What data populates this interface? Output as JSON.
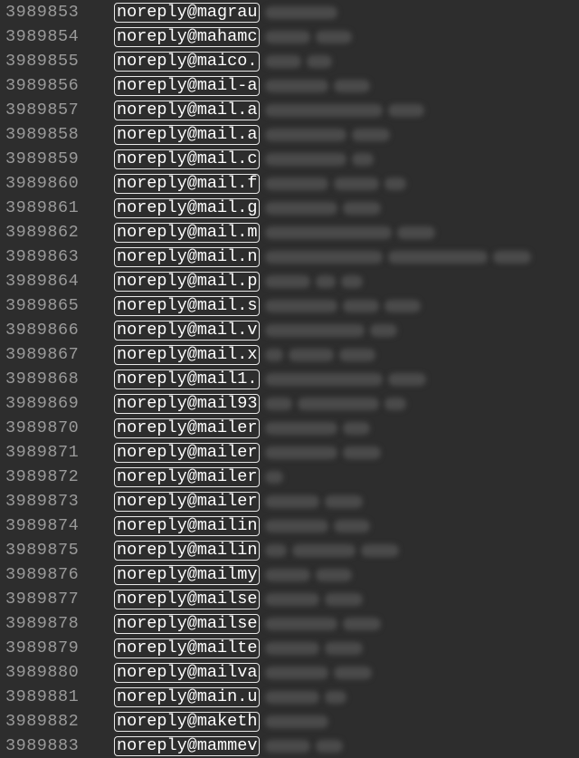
{
  "rows": [
    {
      "line": "3989853",
      "match": "noreply@magrau",
      "tail_char": "",
      "tail_widths": [
        80
      ]
    },
    {
      "line": "3989854",
      "match": "noreply@mahamc",
      "tail_char": "",
      "tail_widths": [
        50,
        40
      ]
    },
    {
      "line": "3989855",
      "match": "noreply@maico.",
      "tail_char": "",
      "tail_widths": [
        40,
        28
      ]
    },
    {
      "line": "3989856",
      "match": "noreply@mail-a",
      "tail_char": "",
      "tail_widths": [
        70,
        40
      ]
    },
    {
      "line": "3989857",
      "match": "noreply@mail.a",
      "tail_char": "",
      "tail_widths": [
        130,
        40
      ]
    },
    {
      "line": "3989858",
      "match": "noreply@mail.a",
      "tail_char": "",
      "tail_widths": [
        90,
        42
      ]
    },
    {
      "line": "3989859",
      "match": "noreply@mail.c",
      "tail_char": "",
      "tail_widths": [
        90,
        24
      ]
    },
    {
      "line": "3989860",
      "match": "noreply@mail.f",
      "tail_char": "",
      "tail_widths": [
        70,
        50,
        24
      ]
    },
    {
      "line": "3989861",
      "match": "noreply@mail.g",
      "tail_char": "",
      "tail_widths": [
        80,
        42
      ]
    },
    {
      "line": "3989862",
      "match": "noreply@mail.m",
      "tail_char": "",
      "tail_widths": [
        140,
        42
      ]
    },
    {
      "line": "3989863",
      "match": "noreply@mail.n",
      "tail_char": "",
      "tail_widths": [
        130,
        110,
        42
      ]
    },
    {
      "line": "3989864",
      "match": "noreply@mail.p",
      "tail_char": "",
      "tail_widths": [
        50,
        22,
        24
      ]
    },
    {
      "line": "3989865",
      "match": "noreply@mail.s",
      "tail_char": "",
      "tail_widths": [
        80,
        40,
        40
      ]
    },
    {
      "line": "3989866",
      "match": "noreply@mail.v",
      "tail_char": "",
      "tail_widths": [
        110,
        30
      ]
    },
    {
      "line": "3989867",
      "match": "noreply@mail.x",
      "tail_char": "",
      "tail_widths": [
        20,
        50,
        40
      ]
    },
    {
      "line": "3989868",
      "match": "noreply@mail1.",
      "tail_char": "",
      "tail_widths": [
        130,
        42
      ]
    },
    {
      "line": "3989869",
      "match": "noreply@mail93",
      "tail_char": "",
      "tail_widths": [
        30,
        90,
        24
      ]
    },
    {
      "line": "3989870",
      "match": "noreply@mailer",
      "tail_char": "",
      "tail_widths": [
        80,
        30
      ]
    },
    {
      "line": "3989871",
      "match": "noreply@mailer",
      "tail_char": "",
      "tail_widths": [
        80,
        42
      ]
    },
    {
      "line": "3989872",
      "match": "noreply@mailer",
      "tail_char": "",
      "tail_widths": [
        20
      ]
    },
    {
      "line": "3989873",
      "match": "noreply@mailer",
      "tail_char": "",
      "tail_widths": [
        60,
        42
      ]
    },
    {
      "line": "3989874",
      "match": "noreply@mailin",
      "tail_char": "",
      "tail_widths": [
        70,
        40
      ]
    },
    {
      "line": "3989875",
      "match": "noreply@mailin",
      "tail_char": "",
      "tail_widths": [
        24,
        70,
        42
      ]
    },
    {
      "line": "3989876",
      "match": "noreply@mailmy",
      "tail_char": "",
      "tail_widths": [
        50,
        40
      ]
    },
    {
      "line": "3989877",
      "match": "noreply@mailse",
      "tail_char": "",
      "tail_widths": [
        60,
        42
      ]
    },
    {
      "line": "3989878",
      "match": "noreply@mailse",
      "tail_char": "",
      "tail_widths": [
        80,
        42
      ]
    },
    {
      "line": "3989879",
      "match": "noreply@mailte",
      "tail_char": "",
      "tail_widths": [
        60,
        42
      ]
    },
    {
      "line": "3989880",
      "match": "noreply@mailva",
      "tail_char": "",
      "tail_widths": [
        70,
        42
      ]
    },
    {
      "line": "3989881",
      "match": "noreply@main.u",
      "tail_char": "",
      "tail_widths": [
        60,
        24
      ]
    },
    {
      "line": "3989882",
      "match": "noreply@maketh",
      "tail_char": "",
      "tail_widths": [
        70
      ]
    },
    {
      "line": "3989883",
      "match": "noreply@mammev",
      "tail_char": "",
      "tail_widths": [
        50,
        30
      ]
    }
  ]
}
